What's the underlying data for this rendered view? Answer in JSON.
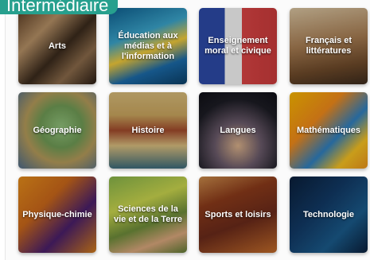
{
  "level_badge": "Intermédiaire",
  "subjects": [
    {
      "label": "Arts"
    },
    {
      "label": "Éducation aux médias et à l'information"
    },
    {
      "label": "Enseignement moral et civique"
    },
    {
      "label": "Français et littératures"
    },
    {
      "label": "Géographie"
    },
    {
      "label": "Histoire"
    },
    {
      "label": "Langues"
    },
    {
      "label": "Mathématiques"
    },
    {
      "label": "Physique-chimie"
    },
    {
      "label": "Sciences de la vie et de la Terre"
    },
    {
      "label": "Sports et loisirs"
    },
    {
      "label": "Technologie"
    }
  ]
}
